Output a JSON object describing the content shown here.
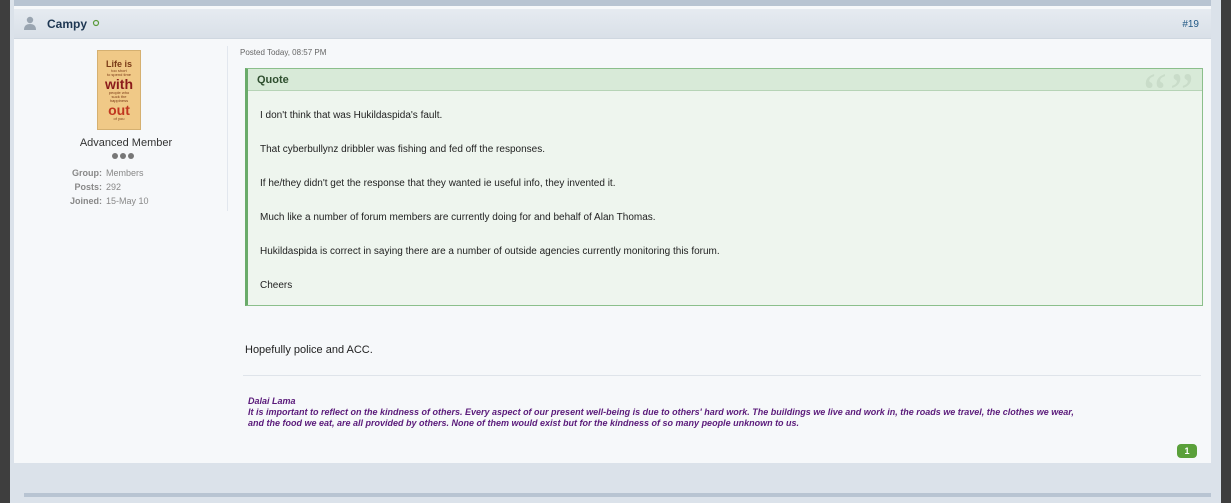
{
  "post": {
    "author": "Campy",
    "post_number": "#19",
    "posted": "Posted Today, 08:57 PM",
    "avatar": {
      "line1": "Life is",
      "line_small1": "too short",
      "line_small2": "to spend time",
      "line2": "with",
      "line_small3": "people who",
      "line_small4": "suck the",
      "line_small5": "happiness",
      "line3": "out",
      "line_small6": "of you"
    },
    "member_title": "Advanced Member",
    "info": {
      "group_label": "Group:",
      "group_value": "Members",
      "posts_label": "Posts:",
      "posts_value": "292",
      "joined_label": "Joined:",
      "joined_value": "15-May 10"
    },
    "quote": {
      "label": "Quote",
      "marks": "“”",
      "lines": [
        "I don't think that was Hukildaspida's fault.",
        "That cyberbullynz dribbler was fishing and fed off the responses.",
        "If he/they didn't get the response that they wanted ie useful info, they invented it.",
        "Much like a number of forum members are currently doing for and behalf of Alan Thomas.",
        "Hukildaspida is correct in saying there are a number of outside agencies currently monitoring this forum.",
        "Cheers"
      ]
    },
    "reply": "Hopefully police and ACC.",
    "signature": {
      "line1": "Dalai Lama",
      "line2": "It is important to reflect on the kindness of others. Every aspect of our present well-being is due to others' hard work. The buildings we live and work in, the roads we travel, the clothes we wear,",
      "line3": "and the food we eat, are all provided by others. None of them would exist but for the kindness of so many people unknown to us."
    },
    "reputation": "1"
  },
  "colors": {
    "quote_border": "#6aab6a",
    "signature": "#5a1a7a",
    "rep_badge": "#5aa03a",
    "author_link": "#1d3652"
  }
}
